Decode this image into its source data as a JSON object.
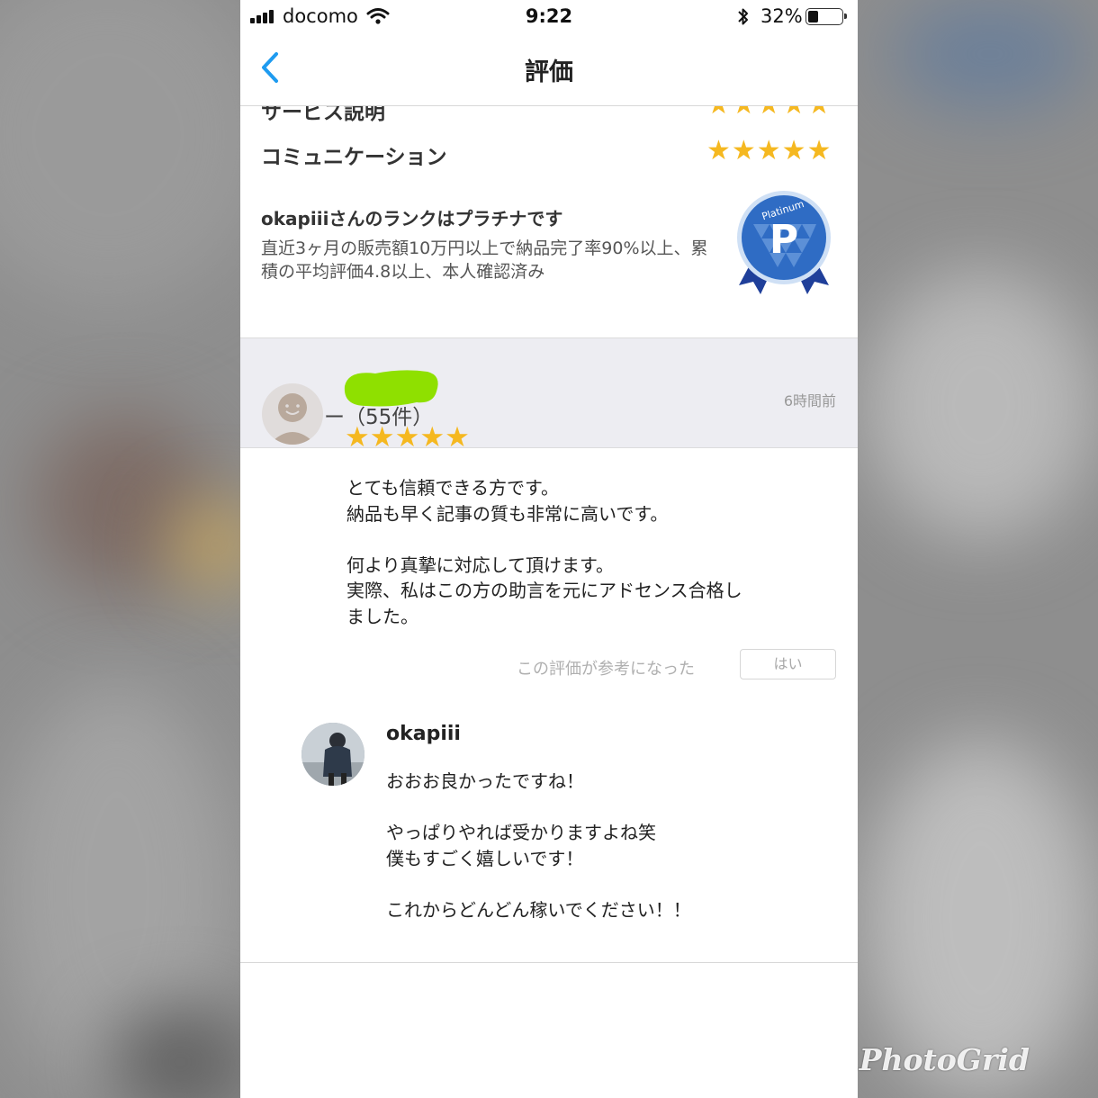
{
  "status_bar": {
    "carrier": "docomo",
    "time": "9:22",
    "battery_percent": "32%",
    "battery_level": 0.32
  },
  "nav": {
    "title": "評価",
    "back_icon": "chevron-left-icon"
  },
  "ratings": [
    {
      "label": "サービス説明",
      "stars": "★★★★★"
    },
    {
      "label": "コミュニケーション",
      "stars": "★★★★★"
    }
  ],
  "rank": {
    "title": "okapiiiさんのランクはプラチナです",
    "description": "直近3ヶ月の販売額10万円以上で納品完了率90%以上、累積の平均評価4.8以上、本人確認済み",
    "badge_text": "Platinum",
    "badge_letter": "P"
  },
  "reviews_header": "レビュー（55件）",
  "review": {
    "time": "6時間前",
    "stars": "★★★★★",
    "body": "とても信頼できる方です。\n納品も早く記事の質も非常に高いです。\n\n何より真摯に対応して頂けます。\n実際、私はこの方の助言を元にアドセンス合格し\nました。",
    "helpful_label": "この評価が参考になった",
    "helpful_button": "はい"
  },
  "reply": {
    "name": "okapiii",
    "body": "おおお良かったですね！\n\nやっぱりやれば受かりますよね笑\n僕もすごく嬉しいです！\n\nこれからどんどん稼いでください！！"
  },
  "watermark": "PhotoGrid",
  "colors": {
    "star": "#f5b820",
    "back_chevron": "#1e9bf0",
    "section_bg": "#ededf2",
    "badge_blue": "#2d63b8"
  }
}
